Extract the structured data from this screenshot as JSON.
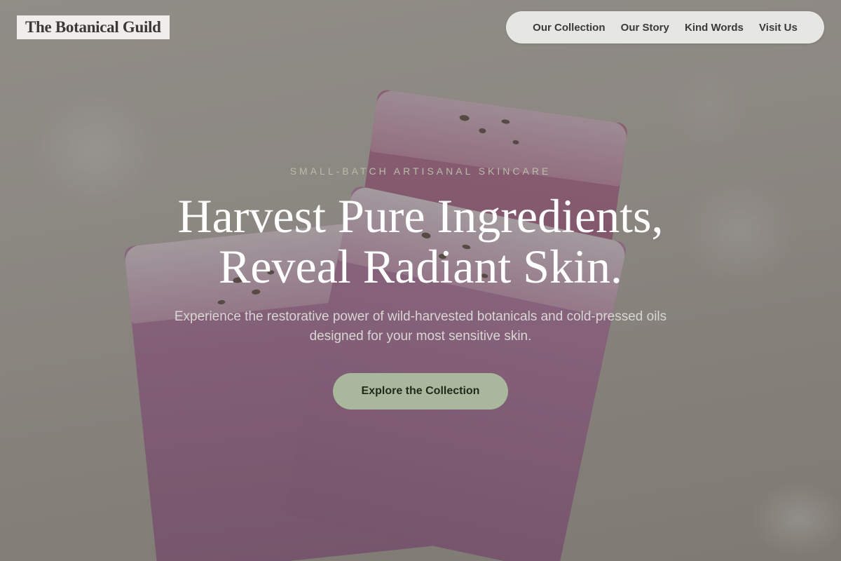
{
  "header": {
    "brand": "The Botanical Guild",
    "nav": [
      {
        "label": "Our Collection"
      },
      {
        "label": "Our Story"
      },
      {
        "label": "Kind Words"
      },
      {
        "label": "Visit Us"
      }
    ]
  },
  "hero": {
    "eyebrow": "Small-Batch Artisanal Skincare",
    "headline_line1": "Harvest Pure Ingredients,",
    "headline_line2": "Reveal Radiant Skin.",
    "subtext_line1": "Experience the restorative power of wild-harvested botanicals and cold-pressed oils",
    "subtext_line2": "designed for your most sensitive skin.",
    "cta_label": "Explore the Collection"
  },
  "colors": {
    "accent": "#a9b89c",
    "nav_bg": "#e6e7e2",
    "brand_bg": "#efeeea"
  }
}
